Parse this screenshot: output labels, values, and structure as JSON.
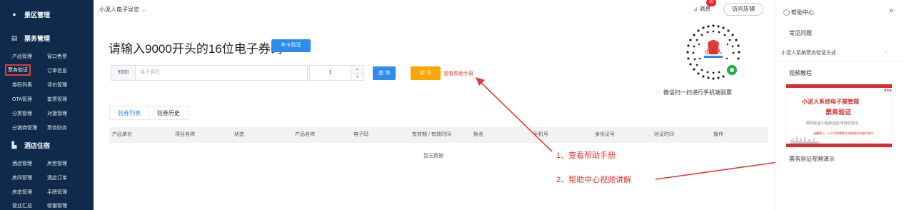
{
  "sidebar": {
    "sections": [
      {
        "icon": "location-pin-icon",
        "glyph": "●",
        "label": "景区管理"
      },
      {
        "icon": "ticket-icon",
        "glyph": "▤",
        "label": "票务管理"
      },
      {
        "icon": "hotel-icon",
        "glyph": "▙",
        "label": "酒店住宿"
      }
    ],
    "ticket_items": [
      [
        "产品管理",
        "窗口售票"
      ],
      [
        "票务验证",
        "订单信息"
      ],
      [
        "券码列表",
        "评价管理"
      ],
      [
        "OTA管理",
        "套票管理"
      ],
      [
        "分类管理",
        "对接管理"
      ],
      [
        "分销商管理",
        "票务财务"
      ]
    ],
    "hotel_items": [
      [
        "酒店管理",
        "房型管理"
      ],
      [
        "房间管理",
        "酒店订单"
      ],
      [
        "房态管理",
        "手牌管理"
      ],
      [
        "营业汇总",
        "收银管理"
      ]
    ]
  },
  "header": {
    "title": "小泥人电子导览",
    "caret": "⌄",
    "message_label": "消息",
    "message_icon": "bell-icon",
    "message_glyph": "♫",
    "badge_count": "20",
    "visit_store_label": "访问店铺"
  },
  "verify": {
    "headline": "请输入9000开头的16位电子券码",
    "year_card_button": "年卡验证",
    "code_prefix": "9000",
    "code_placeholder": "电子券码",
    "quantity": "1",
    "query_button": "查 询",
    "verify_button": "验 证",
    "help_link": "查看帮助手册"
  },
  "qr": {
    "caption": "微信扫一扫进行手机端验票",
    "logo_text": "小泥人"
  },
  "tabs": [
    "验券列表",
    "验券历史"
  ],
  "table": {
    "columns": [
      "产品单价",
      "项目名称",
      "状态",
      "产品名称",
      "电子码",
      "有效期 / 有效时间",
      "姓名",
      "手机号",
      "身份证号",
      "验证时间",
      "操作"
    ],
    "empty_text": "暂无数据"
  },
  "annotations": {
    "note1": "1、查看帮助手册",
    "note2": "2、帮助中心视频讲解",
    "color": "#e53935"
  },
  "help_panel": {
    "title": "帮助中心",
    "expand_glyph": "»",
    "faq_title": "常见问题",
    "faq_item": "小泥人系统票务验证方式",
    "faq_chevron": "›",
    "video_title": "视频教程",
    "video_label": "票务验证视频演示",
    "thumb": {
      "line1": "小泥人系统电子票管理",
      "line2": "票务验证",
      "line3": "网页验证/小程序验证/手持机验证",
      "line4": "温馨提示：以下内容需要在电脑端浏览器中操作",
      "dots": "●●●●"
    }
  },
  "colors": {
    "sidebar_bg": "#0f2a4a",
    "primary": "#2d8cf0",
    "warning": "#ffa500",
    "danger": "#e8423b"
  }
}
